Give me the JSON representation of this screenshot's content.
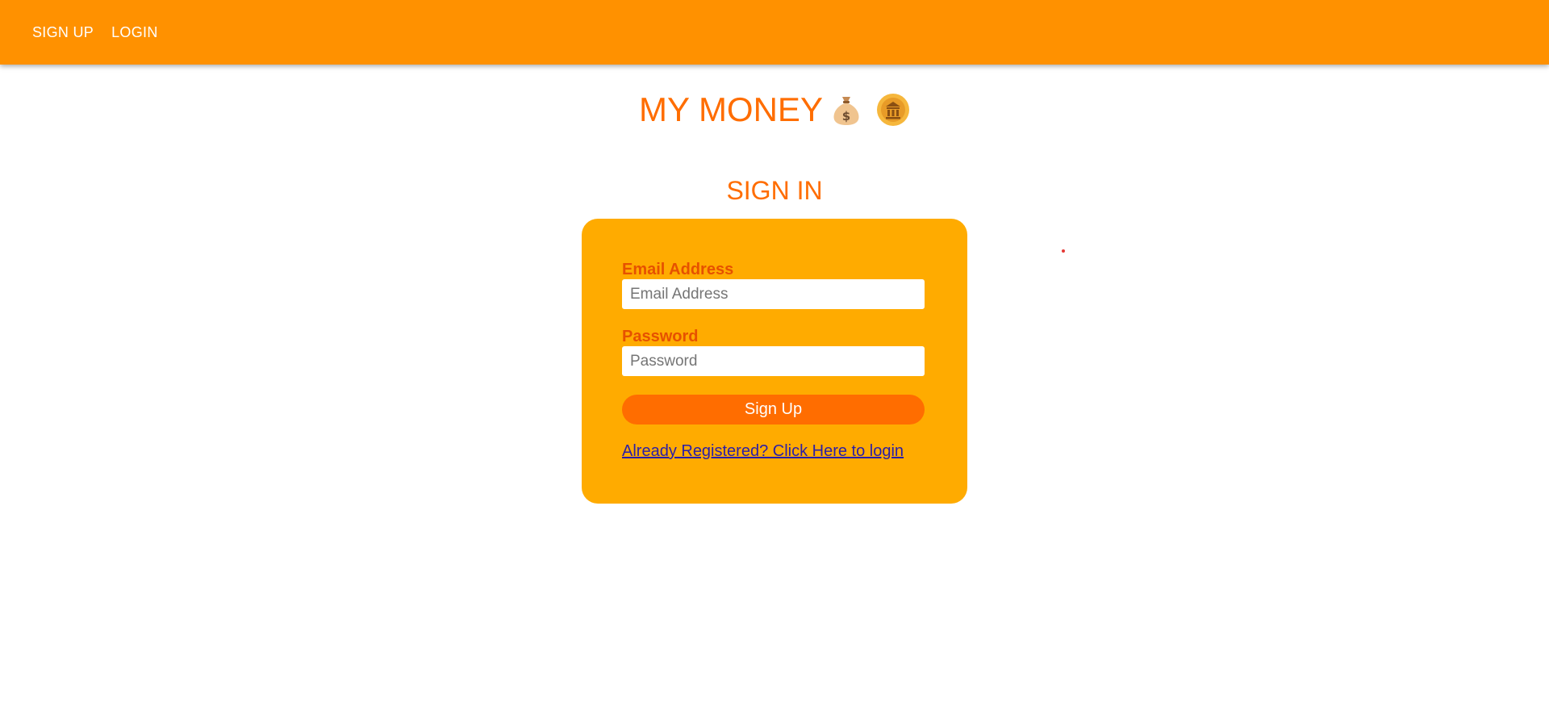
{
  "nav": {
    "signup_label": "SIGN UP",
    "login_label": "LOGIN"
  },
  "header": {
    "app_title": "MY MONEY",
    "icons": [
      "money-bag-icon",
      "coin-icon"
    ]
  },
  "form": {
    "heading": "SIGN IN",
    "email_label": "Email Address",
    "email_placeholder": "Email Address",
    "email_value": "",
    "password_label": "Password",
    "password_placeholder": "Password",
    "password_value": "",
    "submit_label": "Sign Up",
    "login_link": "Already Registered? Click Here to login"
  },
  "colors": {
    "topbar": "#ff9100",
    "accent": "#ff6d00",
    "card": "#ffab00",
    "label": "#e65100",
    "link": "#2a1ea8"
  }
}
